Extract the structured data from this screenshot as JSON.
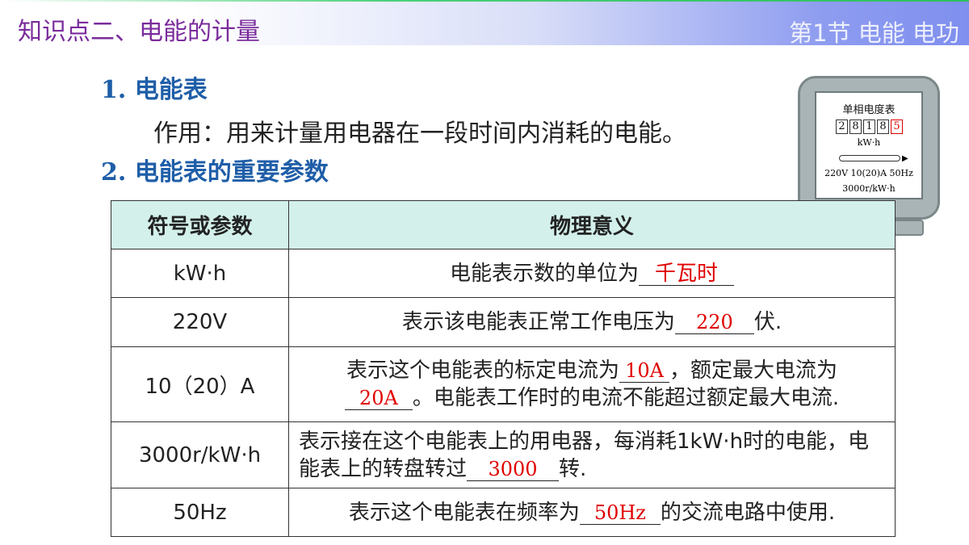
{
  "header": {
    "title": "知识点二、电能的计量",
    "section": "第1节 电能 电功"
  },
  "heading1": "1. 电能表",
  "description": "作用：用来计量用电器在一段时间内消耗的电能。",
  "heading2": "2. 电能表的重要参数",
  "meter": {
    "title": "单相电度表",
    "digits": [
      "2",
      "8",
      "1",
      "8",
      "5"
    ],
    "unit": "kW·h",
    "spec1": "220V 10(20)A 50Hz",
    "spec2": "3000r/kW·h"
  },
  "table": {
    "headers": [
      "符号或参数",
      "物理意义"
    ],
    "rows": [
      {
        "symbol": "kW·h",
        "pre": "电能表示数的单位为",
        "blank": "千瓦时",
        "post": ""
      },
      {
        "symbol": "220V",
        "pre": "表示该电能表正常工作电压为",
        "blank": "220",
        "post": "伏."
      },
      {
        "symbol": "10（20）A",
        "pre": "表示这个电能表的标定电流为",
        "blank": "10A",
        "mid": "，额定最大电流为",
        "blank2": "20A",
        "post": "。电能表工作时的电流不能超过额定最大电流."
      },
      {
        "symbol": "3000r/kW·h",
        "pre": "表示接在这个电能表上的用电器，每消耗1kW·h时的电能，电能表上的转盘转过",
        "blank": "3000",
        "post": "转."
      },
      {
        "symbol": "50Hz",
        "pre": "表示这个电能表在频率为",
        "blank": "50Hz",
        "post": "的交流电路中使用."
      }
    ]
  },
  "colors": {
    "heading": "#1f5ea8",
    "title": "#7a2c9c",
    "answer": "#e00000",
    "table_header_bg": "#d3f0ea"
  }
}
